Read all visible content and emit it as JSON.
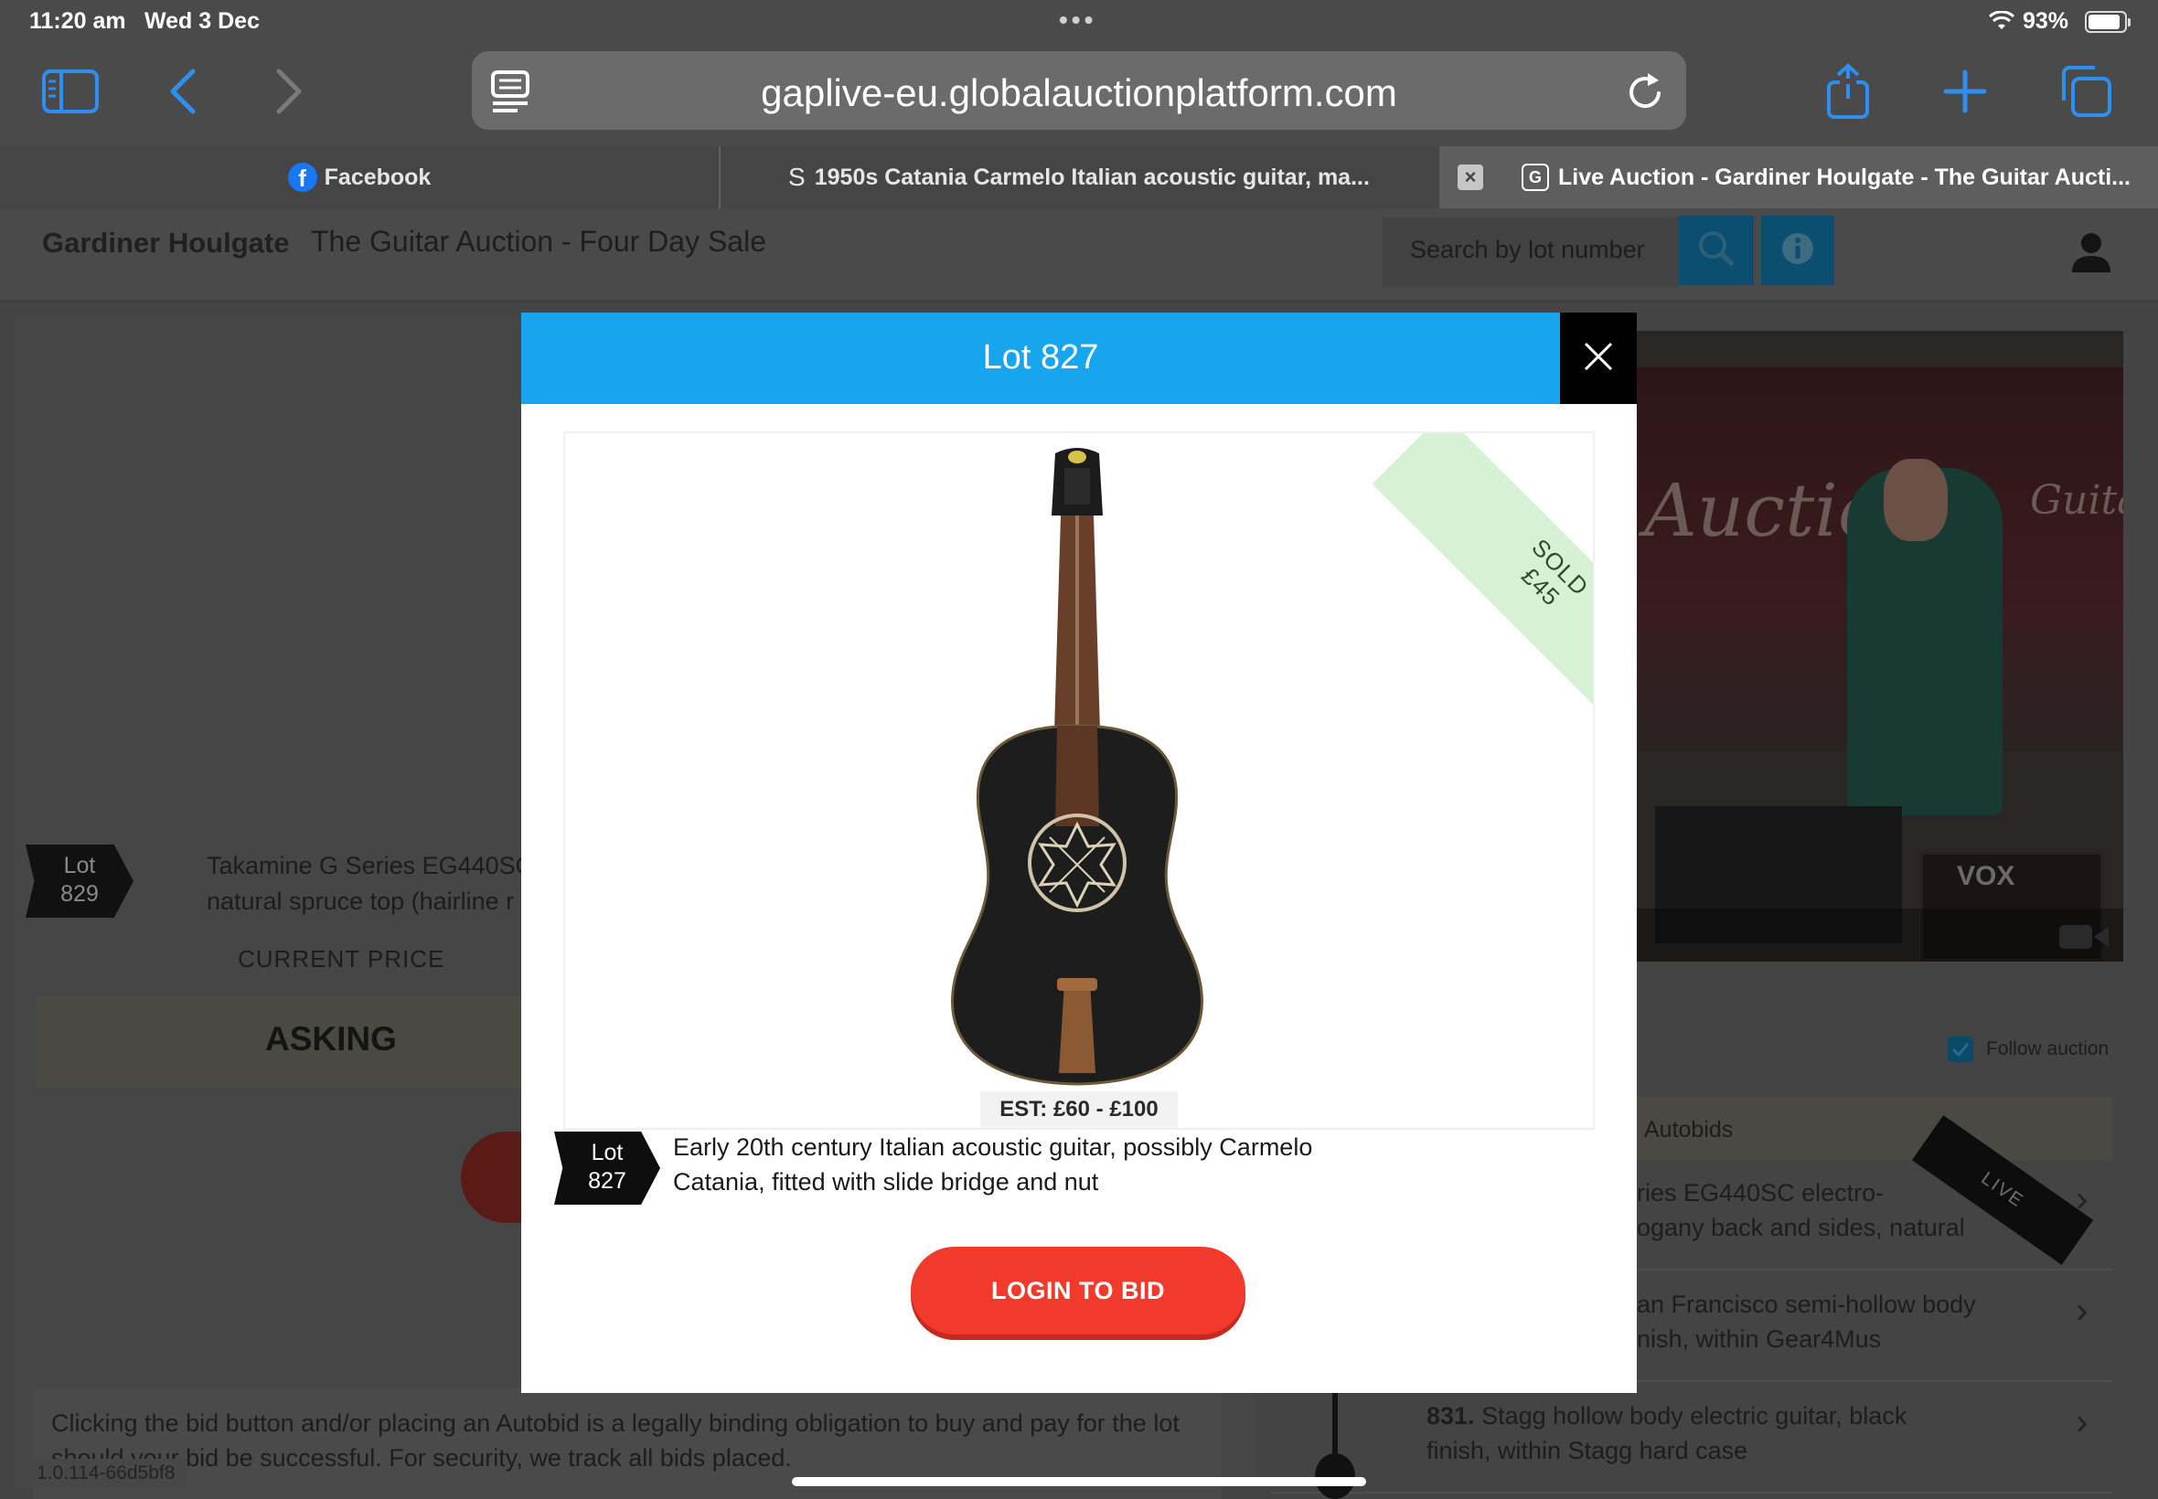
{
  "status_bar": {
    "time": "11:20 am",
    "date": "Wed 3 Dec",
    "dots": "•••",
    "battery": "93%"
  },
  "browser": {
    "url": "gaplive-eu.globalauctionplatform.com",
    "tabs": [
      {
        "label": "Facebook",
        "favicon": "f"
      },
      {
        "label": "1950s Catania Carmelo Italian acoustic guitar, ma...",
        "favicon": "S"
      },
      {
        "label": "Live Auction - Gardiner Houlgate - The Guitar Aucti...",
        "favicon": "G",
        "active": true
      }
    ],
    "tab_close": "×"
  },
  "header": {
    "auctioneer": "Gardiner Houlgate",
    "sale_name": "The Guitar Auction - Four Day Sale",
    "search_placeholder": "Search by lot number"
  },
  "background_lot": {
    "lot_label": "Lot",
    "lot_number": "829",
    "description": "Takamine G Series EG440SC\nnatural spruce top (hairline r",
    "current_price_label": "CURRENT PRICE",
    "asking_label": "ASKING"
  },
  "legal_text": "Clicking the bid button and/or placing an Autobid is a legally binding obligation to buy and pay for the lot should your bid be successful. For security, we track all bids placed.",
  "version": "1.0.114-66d5bf8",
  "sidebar": {
    "follow_label": "Follow auction",
    "autobids_label": "Autobids",
    "live_label": "LIVE",
    "items": [
      {
        "text": "ries EG440SC electro-\nogany back and sides, natural"
      },
      {
        "text": "an Francisco semi-hollow body\nnish, within Gear4Mus"
      },
      {
        "number": "831.",
        "text": "Stagg hollow body electric guitar, black\nfinish, within Stagg hard case"
      }
    ]
  },
  "video": {
    "banner_text_1": "Auctio",
    "banner_text_2": "Guitar",
    "amp_brand": "VOX"
  },
  "modal": {
    "title": "Lot 827",
    "ribbon_status": "SOLD",
    "ribbon_price": "£45",
    "estimate": "EST: £60 - £100",
    "lot_label": "Lot",
    "lot_number": "827",
    "description": "Early 20th century Italian acoustic guitar, possibly Carmelo Catania, fitted with slide bridge and nut",
    "login_button": "LOGIN TO BID"
  },
  "colors": {
    "modal_header": "#17a6ee",
    "login_button": "#f23a2c",
    "sold_ribbon": "#d6f1d3"
  },
  "icons": [
    "sidebar-icon",
    "back-icon",
    "forward-icon",
    "reader-icon",
    "reload-icon",
    "share-icon",
    "new-tab-icon",
    "tabs-icon",
    "search-icon",
    "info-icon",
    "user-icon",
    "close-icon",
    "camera-icon",
    "wifi-icon",
    "battery-icon",
    "check-icon",
    "chevron-right-icon"
  ]
}
